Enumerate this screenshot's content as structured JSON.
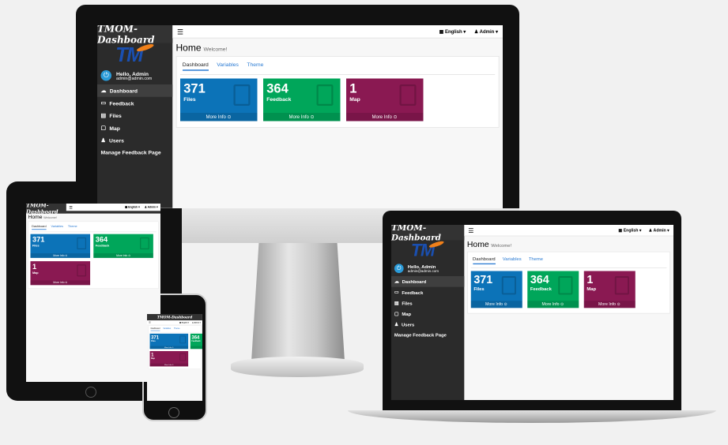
{
  "app": {
    "brand": "TMOM-Dashboard",
    "logo_text": "TM",
    "user": {
      "name": "Hello, Admin",
      "email": "admin@admin.com"
    },
    "nav": [
      {
        "icon": "dashboard-icon",
        "label": "Dashboard",
        "active": true
      },
      {
        "icon": "feedback-icon",
        "label": "Feedback"
      },
      {
        "icon": "files-icon",
        "label": "Files"
      },
      {
        "icon": "map-icon",
        "label": "Map"
      },
      {
        "icon": "users-icon",
        "label": "Users"
      }
    ],
    "manage_link": "Manage Feedback Page",
    "topbar": {
      "language": "English ▾",
      "account": "Admin ▾"
    },
    "page_title": "Home",
    "page_subtitle": "Welcome!",
    "tabs": [
      "Dashboard",
      "Variables",
      "Theme"
    ],
    "boxes": [
      {
        "value": "371",
        "label": "Files",
        "more": "More Info ⊙",
        "color": "#0c73b8"
      },
      {
        "value": "364",
        "label": "Feedback",
        "more": "More Info ⊙",
        "color": "#00a65a"
      },
      {
        "value": "1",
        "label": "Map",
        "more": "More Info ⊙",
        "color": "#8a1952"
      }
    ]
  }
}
